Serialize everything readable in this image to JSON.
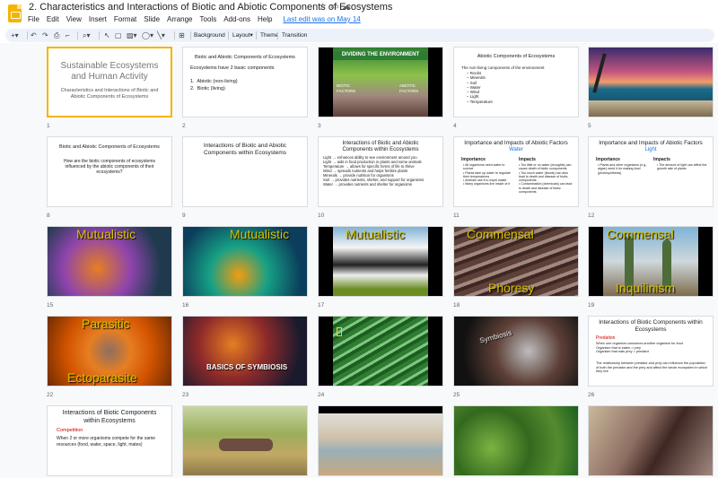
{
  "header": {
    "title": "2. Characteristics and Interactions of Biotic and Abiotic Components of Ecosystems",
    "last_edit": "Last edit was on May 14",
    "menu": [
      "File",
      "Edit",
      "View",
      "Insert",
      "Format",
      "Slide",
      "Arrange",
      "Tools",
      "Add-ons",
      "Help"
    ]
  },
  "toolbar": {
    "background": "Background",
    "layout": "Layout",
    "theme": "Theme",
    "transition": "Transition"
  },
  "slides": {
    "s1": {
      "num": "1",
      "title": "Sustainable Ecosystems and Human Activity",
      "subtitle": "Characteristics and Interactions of Biotic and Abiotic Components of Ecosystems"
    },
    "s2": {
      "num": "2",
      "title": "Biotic and Abiotic Components of Ecosystems",
      "body": "Ecosystems have 2 basic components",
      "items": [
        "Abiotic (non-living)",
        "Biotic (living)"
      ]
    },
    "s3": {
      "num": "3",
      "title": "DIVIDING THE ENVIRONMENT",
      "left": "BIOTIC FACTORS",
      "right": "ABIOTIC FACTORS"
    },
    "s4": {
      "num": "4",
      "title": "Abiotic Components of Ecosystems",
      "body": "The non-living components of the environment",
      "items": [
        "Rocks",
        "Minerals",
        "Soil",
        "Water",
        "Wind",
        "Light",
        "Temperature"
      ]
    },
    "s5": {
      "num": "5"
    },
    "s6": {
      "num": "8",
      "title": "Biotic and Abiotic Components of Ecosystems",
      "body": "How are the biotic components of ecosystems influenced by the abiotic components of their ecosystems?"
    },
    "s7": {
      "num": "9",
      "title": "Interactions of Biotic and Abiotic Components within Ecosystems"
    },
    "s8": {
      "num": "10",
      "title": "Interactions of Biotic and Abiotic Components within Ecosystems",
      "lines": [
        "Light → enhances ability to see environment around you",
        "Light → aids in food production in plants and some animals",
        "Temperature → allows for specific forms of life to thrive",
        "Wind → spreads nutrients and helps fertilize plants",
        "Minerals → provide nutrition for organisms",
        "Soil → provides nutrients, shelter, and support for organisms",
        "Water → provides nutrients and shelter for organisms"
      ]
    },
    "s9": {
      "num": "11",
      "title": "Importance and Impacts of Abiotic Factors",
      "subtitle": "Water",
      "col1": "Importance",
      "col2": "Impacts",
      "imp": [
        "All organisms need water to survive",
        "Plants take up water to regulate their temperatures",
        "Animals use it to expel waste",
        "Many organisms live inside of it"
      ],
      "impacts": [
        "Too little or no water (droughts) can cause death of biotic components",
        "Too much water (floods) can also lead to death and disease of biotic components",
        "Contamination (chemicals) can lead to death and disease of biotic components"
      ]
    },
    "s10": {
      "num": "12",
      "title": "Importance and Impacts of Abiotic Factors",
      "subtitle": "Light",
      "col1": "Importance",
      "col2": "Impacts",
      "imp": [
        "Plants and other organisms (e.g., algae) need it for making food (photosynthesis)"
      ],
      "impacts": [
        "The amount of light can affect the growth rate of plants"
      ]
    },
    "s11": {
      "num": "15",
      "overlay": "Mutualistic"
    },
    "s12": {
      "num": "16",
      "overlay": "Mutualistic"
    },
    "s13": {
      "num": "17",
      "overlay": "Mutualistic"
    },
    "s14": {
      "num": "18",
      "overlay_top": "Commensal",
      "overlay_bottom": "Phoresy"
    },
    "s15": {
      "num": "19",
      "overlay_top": "Commensal",
      "overlay_bottom": "Inquilinism"
    },
    "s16": {
      "num": "22",
      "overlay_top": "Parasitic",
      "overlay_bottom": "Ectoparasite"
    },
    "s17": {
      "num": "23",
      "overlay": "BASICS OF SYMBIOSIS"
    },
    "s18": {
      "num": "24"
    },
    "s19": {
      "num": "25",
      "overlay": "Symbiosis"
    },
    "s20": {
      "num": "26",
      "title": "Interactions of Biotic Components within Ecosystems",
      "subtitle": "Predation",
      "lines": [
        "When one organism consumes another organism for food",
        "Organism that is eaten = prey",
        "Organism that eats prey = predator"
      ],
      "body": "The relationship between predator and prey can influence the population of both the predator and the prey and affect the whole ecosystem in which they live"
    },
    "s21": {
      "title": "Interactions of Biotic Components within Ecosystems",
      "subtitle": "Competition",
      "body": "When 2 or more organisms compete for the same resources (food, water, space, light, mates)"
    }
  },
  "colors": {
    "accent": "#f4b400",
    "link": "#1a73e8",
    "overlay": "#d9c400",
    "red": "#cc0000"
  }
}
